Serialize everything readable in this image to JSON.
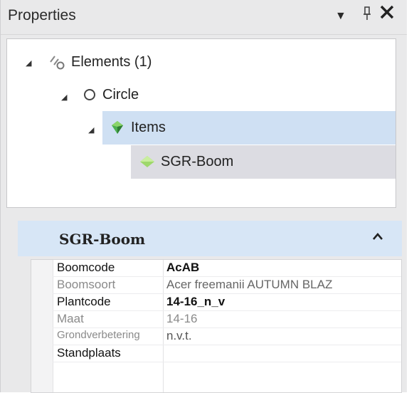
{
  "panel": {
    "title": "Properties",
    "dropdown_glyph": "▼",
    "pin_glyph": "ᵗ",
    "close_glyph": "✕"
  },
  "tree": {
    "elements_label": "Elements (1)",
    "circle_label": "Circle",
    "items_label": "Items",
    "sgr_label": "SGR-Boom"
  },
  "card": {
    "title": "SGR-Boom",
    "collapse_glyph": "^"
  },
  "properties": [
    {
      "name": "Boomcode",
      "value": "AcAB"
    },
    {
      "name": "Boomsoort",
      "value": "Acer freemanii AUTUMN BLAZ"
    },
    {
      "name": "Plantcode",
      "value": "14-16_n_v"
    },
    {
      "name": "Maat",
      "value": "14-16"
    },
    {
      "name": "Grondverbetering",
      "value": "n.v.t."
    },
    {
      "name": "Standplaats",
      "value": ""
    }
  ]
}
